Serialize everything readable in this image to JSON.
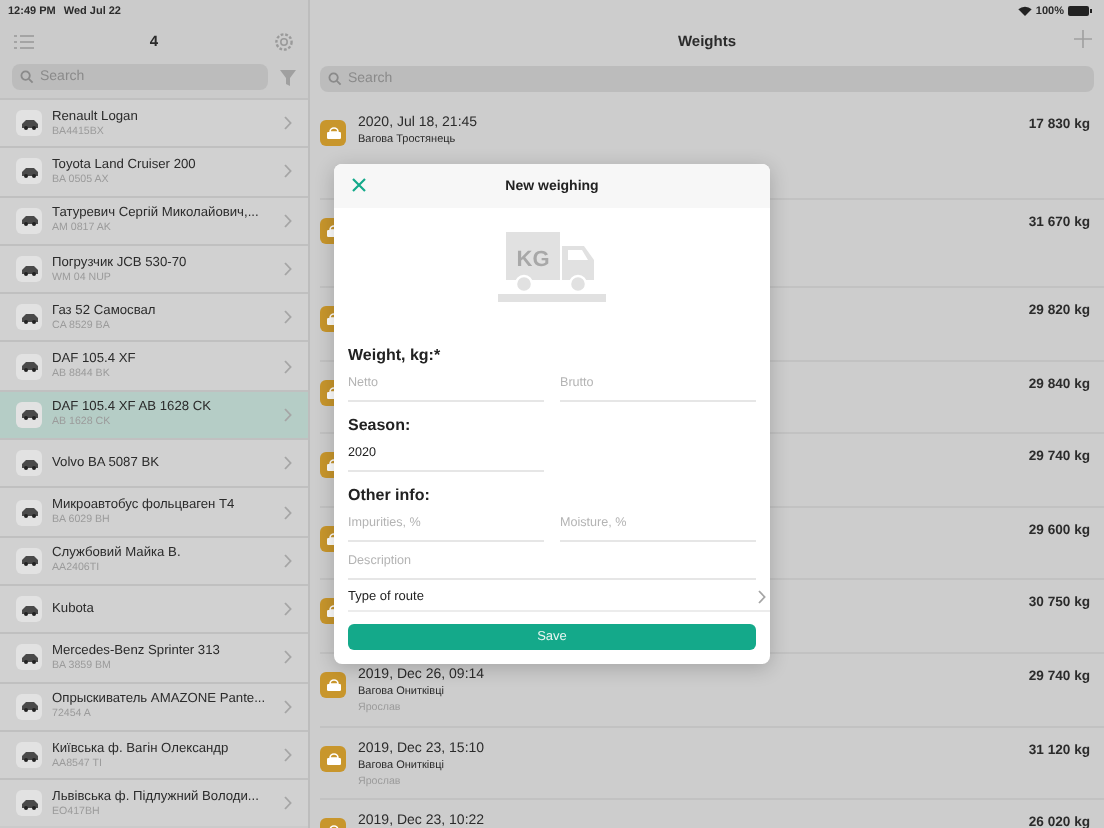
{
  "status_bar": {
    "time": "12:49 PM",
    "date": "Wed Jul 22",
    "battery": "100%"
  },
  "sidebar": {
    "title": "4",
    "search": {
      "placeholder": "Search"
    },
    "items": [
      {
        "name": "Renault Logan",
        "plate": "BA4415BX",
        "selected": false
      },
      {
        "name": "Toyota Land Cruiser 200",
        "plate": "BA 0505 AX",
        "selected": false
      },
      {
        "name": "Татуревич Сергій Миколайович,...",
        "plate": "AM 0817 AK",
        "selected": false
      },
      {
        "name": "Погрузчик JCB 530-70",
        "plate": "WM 04 NUP",
        "selected": false
      },
      {
        "name": "Газ 52 Самосвал",
        "plate": "CA 8529 BA",
        "selected": false
      },
      {
        "name": "DAF 105.4 XF",
        "plate": "AB 8844 BK",
        "selected": false
      },
      {
        "name": "DAF 105.4 XF AB 1628 CK",
        "plate": "AB 1628 CK",
        "selected": true
      },
      {
        "name": "Volvo BA 5087 BK",
        "selected": false
      },
      {
        "name": "Микроавтобус фольцваген Т4",
        "plate": "BA 6029 BH",
        "selected": false
      },
      {
        "name": "Службовий Майка В.",
        "plate": "AA2406TI",
        "selected": false
      },
      {
        "name": "Kubota",
        "selected": false
      },
      {
        "name": "Mercedes-Benz Sprinter 313",
        "plate": "BA 3859 BM",
        "selected": false
      },
      {
        "name": "Опрыскиватель AMAZONE Pante...",
        "plate": "72454 A",
        "selected": false
      },
      {
        "name": "Київська ф. Вагін Олександр",
        "plate": "AA8547 TI",
        "selected": false
      },
      {
        "name": "Львівська ф. Підлужний Володи...",
        "plate": "EO417BH",
        "selected": false
      }
    ]
  },
  "weights": {
    "title": "Weights",
    "search": {
      "placeholder": "Search"
    },
    "rows": [
      {
        "date": "2020, Jul 18, 21:45",
        "scale": "Вагова Тростянець",
        "weight": "17 830 kg"
      },
      {
        "weight": "31 670 kg"
      },
      {
        "weight": "29 820 kg"
      },
      {
        "weight": "29 840 kg"
      },
      {
        "weight": "29 740 kg"
      },
      {
        "weight": "29 600 kg"
      },
      {
        "weight": "30 750 kg"
      },
      {
        "date": "2019, Dec 26, 09:14",
        "scale": "Вагова Онитківці",
        "operator": "Ярослав",
        "weight": "29 740 kg"
      },
      {
        "date": "2019, Dec 23, 15:10",
        "scale": "Вагова Онитківці",
        "operator": "Ярослав",
        "weight": "31 120 kg"
      },
      {
        "date": "2019, Dec 23, 10:22",
        "weight": "26 020 kg"
      }
    ]
  },
  "modal": {
    "title": "New weighing",
    "illustration_label": "KG",
    "sections": [
      {
        "heading": "Weight, kg:*",
        "fields": [
          {
            "placeholder": "Netto"
          },
          {
            "placeholder": "Brutto"
          }
        ]
      },
      {
        "heading": "Season:",
        "fields": [
          {
            "value": "2020"
          }
        ]
      },
      {
        "heading": "Other info:",
        "fields": [
          {
            "placeholder": "Impurities, %"
          },
          {
            "placeholder": "Moisture, %"
          }
        ],
        "full_fields": [
          {
            "placeholder": "Description"
          }
        ]
      }
    ],
    "route": {
      "label": "Type of route"
    },
    "save_button": "Save"
  }
}
